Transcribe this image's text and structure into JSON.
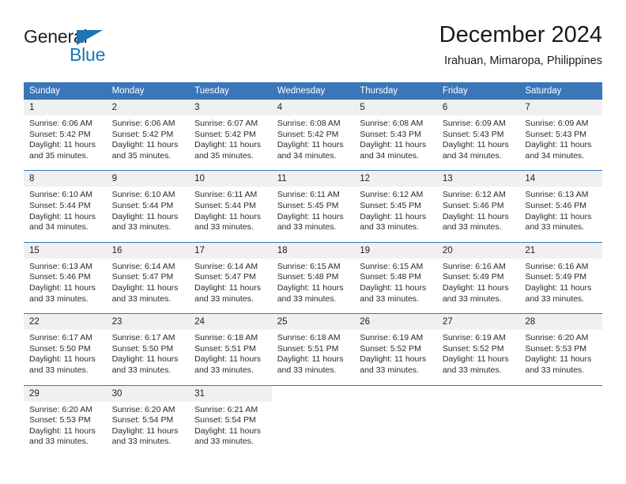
{
  "brand": {
    "name_part1": "General",
    "name_part2": "Blue",
    "triangle_icon": "brand-triangle-icon",
    "accent_color": "#1b75bb"
  },
  "header": {
    "title": "December 2024",
    "subtitle": "Irahuan, Mimaropa, Philippines"
  },
  "calendar": {
    "header_bg": "#3a76b8",
    "daynum_bg": "#f0f0f0",
    "weekday_headers": [
      "Sunday",
      "Monday",
      "Tuesday",
      "Wednesday",
      "Thursday",
      "Friday",
      "Saturday"
    ],
    "weeks": [
      [
        {
          "day": "1",
          "sunrise": "Sunrise: 6:06 AM",
          "sunset": "Sunset: 5:42 PM",
          "daylight_line1": "Daylight: 11 hours",
          "daylight_line2": "and 35 minutes."
        },
        {
          "day": "2",
          "sunrise": "Sunrise: 6:06 AM",
          "sunset": "Sunset: 5:42 PM",
          "daylight_line1": "Daylight: 11 hours",
          "daylight_line2": "and 35 minutes."
        },
        {
          "day": "3",
          "sunrise": "Sunrise: 6:07 AM",
          "sunset": "Sunset: 5:42 PM",
          "daylight_line1": "Daylight: 11 hours",
          "daylight_line2": "and 35 minutes."
        },
        {
          "day": "4",
          "sunrise": "Sunrise: 6:08 AM",
          "sunset": "Sunset: 5:42 PM",
          "daylight_line1": "Daylight: 11 hours",
          "daylight_line2": "and 34 minutes."
        },
        {
          "day": "5",
          "sunrise": "Sunrise: 6:08 AM",
          "sunset": "Sunset: 5:43 PM",
          "daylight_line1": "Daylight: 11 hours",
          "daylight_line2": "and 34 minutes."
        },
        {
          "day": "6",
          "sunrise": "Sunrise: 6:09 AM",
          "sunset": "Sunset: 5:43 PM",
          "daylight_line1": "Daylight: 11 hours",
          "daylight_line2": "and 34 minutes."
        },
        {
          "day": "7",
          "sunrise": "Sunrise: 6:09 AM",
          "sunset": "Sunset: 5:43 PM",
          "daylight_line1": "Daylight: 11 hours",
          "daylight_line2": "and 34 minutes."
        }
      ],
      [
        {
          "day": "8",
          "sunrise": "Sunrise: 6:10 AM",
          "sunset": "Sunset: 5:44 PM",
          "daylight_line1": "Daylight: 11 hours",
          "daylight_line2": "and 34 minutes."
        },
        {
          "day": "9",
          "sunrise": "Sunrise: 6:10 AM",
          "sunset": "Sunset: 5:44 PM",
          "daylight_line1": "Daylight: 11 hours",
          "daylight_line2": "and 33 minutes."
        },
        {
          "day": "10",
          "sunrise": "Sunrise: 6:11 AM",
          "sunset": "Sunset: 5:44 PM",
          "daylight_line1": "Daylight: 11 hours",
          "daylight_line2": "and 33 minutes."
        },
        {
          "day": "11",
          "sunrise": "Sunrise: 6:11 AM",
          "sunset": "Sunset: 5:45 PM",
          "daylight_line1": "Daylight: 11 hours",
          "daylight_line2": "and 33 minutes."
        },
        {
          "day": "12",
          "sunrise": "Sunrise: 6:12 AM",
          "sunset": "Sunset: 5:45 PM",
          "daylight_line1": "Daylight: 11 hours",
          "daylight_line2": "and 33 minutes."
        },
        {
          "day": "13",
          "sunrise": "Sunrise: 6:12 AM",
          "sunset": "Sunset: 5:46 PM",
          "daylight_line1": "Daylight: 11 hours",
          "daylight_line2": "and 33 minutes."
        },
        {
          "day": "14",
          "sunrise": "Sunrise: 6:13 AM",
          "sunset": "Sunset: 5:46 PM",
          "daylight_line1": "Daylight: 11 hours",
          "daylight_line2": "and 33 minutes."
        }
      ],
      [
        {
          "day": "15",
          "sunrise": "Sunrise: 6:13 AM",
          "sunset": "Sunset: 5:46 PM",
          "daylight_line1": "Daylight: 11 hours",
          "daylight_line2": "and 33 minutes."
        },
        {
          "day": "16",
          "sunrise": "Sunrise: 6:14 AM",
          "sunset": "Sunset: 5:47 PM",
          "daylight_line1": "Daylight: 11 hours",
          "daylight_line2": "and 33 minutes."
        },
        {
          "day": "17",
          "sunrise": "Sunrise: 6:14 AM",
          "sunset": "Sunset: 5:47 PM",
          "daylight_line1": "Daylight: 11 hours",
          "daylight_line2": "and 33 minutes."
        },
        {
          "day": "18",
          "sunrise": "Sunrise: 6:15 AM",
          "sunset": "Sunset: 5:48 PM",
          "daylight_line1": "Daylight: 11 hours",
          "daylight_line2": "and 33 minutes."
        },
        {
          "day": "19",
          "sunrise": "Sunrise: 6:15 AM",
          "sunset": "Sunset: 5:48 PM",
          "daylight_line1": "Daylight: 11 hours",
          "daylight_line2": "and 33 minutes."
        },
        {
          "day": "20",
          "sunrise": "Sunrise: 6:16 AM",
          "sunset": "Sunset: 5:49 PM",
          "daylight_line1": "Daylight: 11 hours",
          "daylight_line2": "and 33 minutes."
        },
        {
          "day": "21",
          "sunrise": "Sunrise: 6:16 AM",
          "sunset": "Sunset: 5:49 PM",
          "daylight_line1": "Daylight: 11 hours",
          "daylight_line2": "and 33 minutes."
        }
      ],
      [
        {
          "day": "22",
          "sunrise": "Sunrise: 6:17 AM",
          "sunset": "Sunset: 5:50 PM",
          "daylight_line1": "Daylight: 11 hours",
          "daylight_line2": "and 33 minutes."
        },
        {
          "day": "23",
          "sunrise": "Sunrise: 6:17 AM",
          "sunset": "Sunset: 5:50 PM",
          "daylight_line1": "Daylight: 11 hours",
          "daylight_line2": "and 33 minutes."
        },
        {
          "day": "24",
          "sunrise": "Sunrise: 6:18 AM",
          "sunset": "Sunset: 5:51 PM",
          "daylight_line1": "Daylight: 11 hours",
          "daylight_line2": "and 33 minutes."
        },
        {
          "day": "25",
          "sunrise": "Sunrise: 6:18 AM",
          "sunset": "Sunset: 5:51 PM",
          "daylight_line1": "Daylight: 11 hours",
          "daylight_line2": "and 33 minutes."
        },
        {
          "day": "26",
          "sunrise": "Sunrise: 6:19 AM",
          "sunset": "Sunset: 5:52 PM",
          "daylight_line1": "Daylight: 11 hours",
          "daylight_line2": "and 33 minutes."
        },
        {
          "day": "27",
          "sunrise": "Sunrise: 6:19 AM",
          "sunset": "Sunset: 5:52 PM",
          "daylight_line1": "Daylight: 11 hours",
          "daylight_line2": "and 33 minutes."
        },
        {
          "day": "28",
          "sunrise": "Sunrise: 6:20 AM",
          "sunset": "Sunset: 5:53 PM",
          "daylight_line1": "Daylight: 11 hours",
          "daylight_line2": "and 33 minutes."
        }
      ],
      [
        {
          "day": "29",
          "sunrise": "Sunrise: 6:20 AM",
          "sunset": "Sunset: 5:53 PM",
          "daylight_line1": "Daylight: 11 hours",
          "daylight_line2": "and 33 minutes."
        },
        {
          "day": "30",
          "sunrise": "Sunrise: 6:20 AM",
          "sunset": "Sunset: 5:54 PM",
          "daylight_line1": "Daylight: 11 hours",
          "daylight_line2": "and 33 minutes."
        },
        {
          "day": "31",
          "sunrise": "Sunrise: 6:21 AM",
          "sunset": "Sunset: 5:54 PM",
          "daylight_line1": "Daylight: 11 hours",
          "daylight_line2": "and 33 minutes."
        },
        {
          "day": "",
          "sunrise": "",
          "sunset": "",
          "daylight_line1": "",
          "daylight_line2": ""
        },
        {
          "day": "",
          "sunrise": "",
          "sunset": "",
          "daylight_line1": "",
          "daylight_line2": ""
        },
        {
          "day": "",
          "sunrise": "",
          "sunset": "",
          "daylight_line1": "",
          "daylight_line2": ""
        },
        {
          "day": "",
          "sunrise": "",
          "sunset": "",
          "daylight_line1": "",
          "daylight_line2": ""
        }
      ]
    ]
  }
}
